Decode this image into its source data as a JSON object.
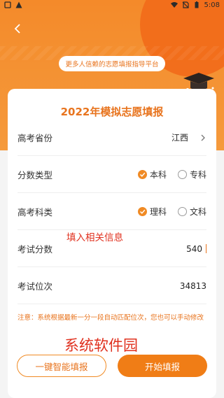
{
  "status_bar": {
    "time": "5:08"
  },
  "header": {
    "tagline": "更多人信赖的志愿填报指导平台"
  },
  "card": {
    "title": "2022年模拟志愿填报",
    "province": {
      "label": "高考省份",
      "value": "江西"
    },
    "score_type": {
      "label": "分数类型",
      "options": [
        "本科",
        "专科"
      ],
      "selected": "本科"
    },
    "subject_type": {
      "label": "高考科类",
      "options": [
        "理科",
        "文科"
      ],
      "selected": "理科"
    },
    "score": {
      "label": "考试分数",
      "value": "540"
    },
    "rank": {
      "label": "考试位次",
      "value": "34813"
    },
    "notice": "注意：系统根据最新一分一段自动匹配位次，您也可以手动修改",
    "buttons": {
      "smart_fill": "一键智能填报",
      "start_fill": "开始填报"
    }
  },
  "annotations": {
    "fill_hint": "填入相关信息",
    "watermark": "系统软件园"
  },
  "colors": {
    "accent": "#f08a24",
    "annotation_red": "#e0301e"
  }
}
